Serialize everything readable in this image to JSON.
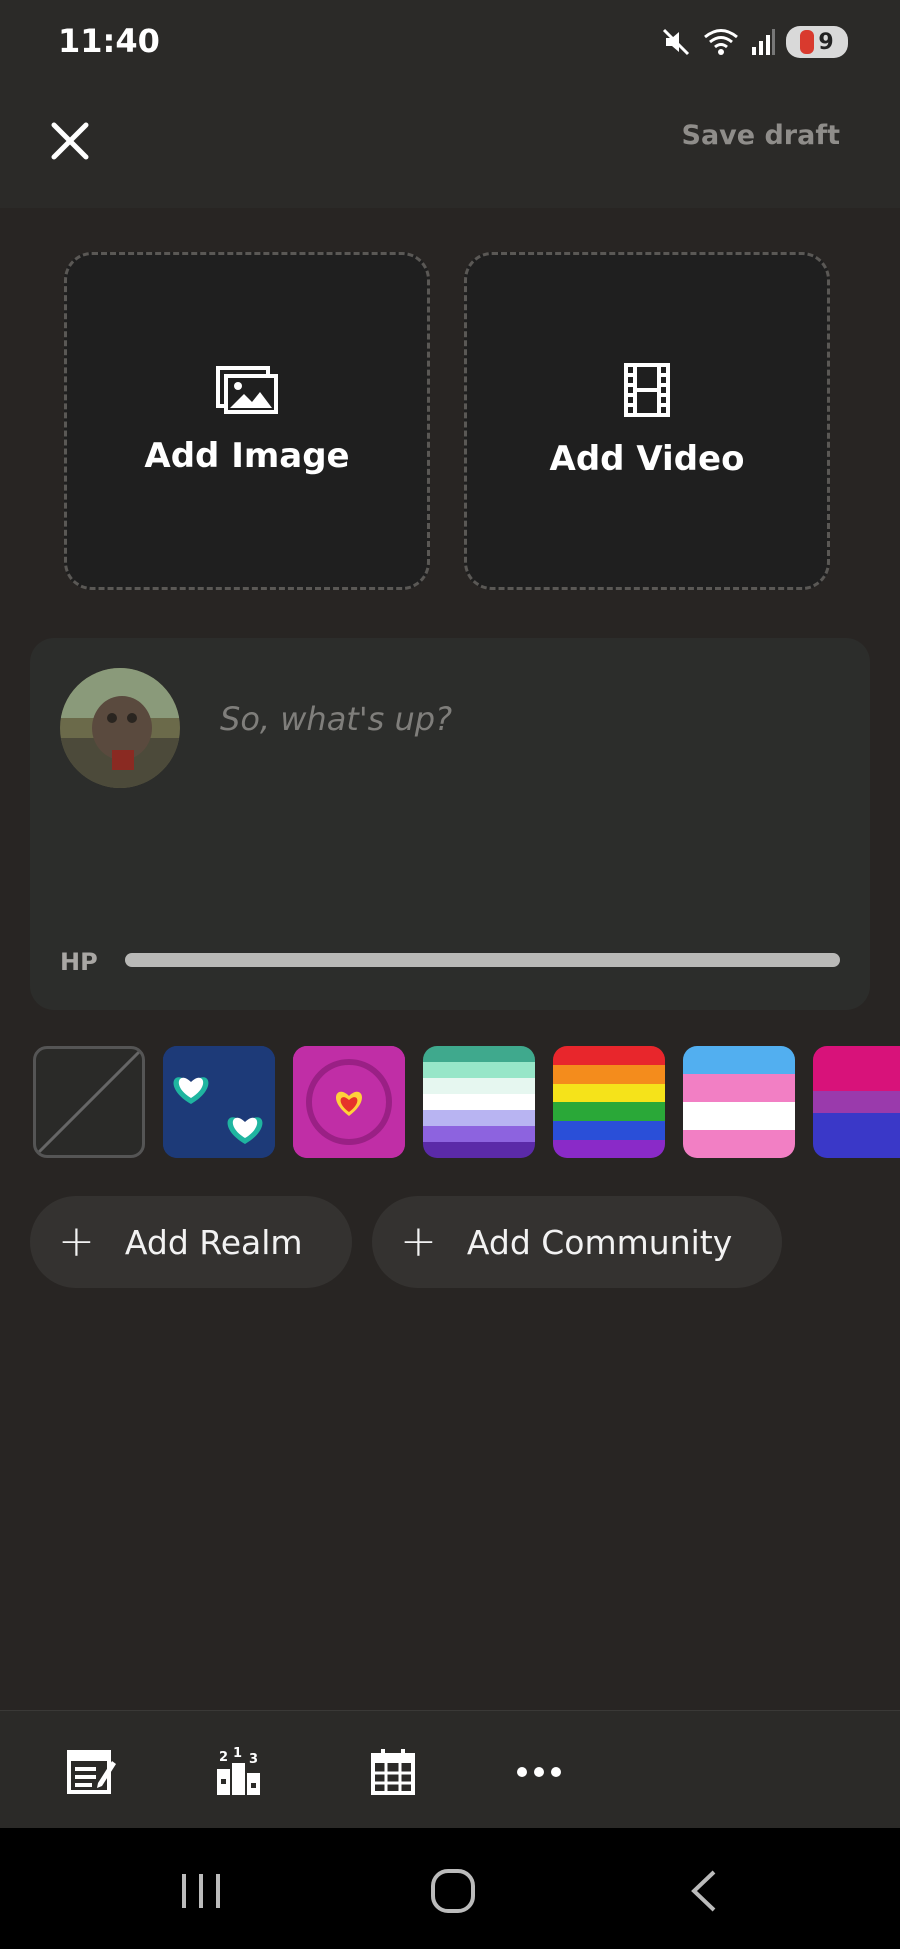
{
  "status": {
    "time": "11:40",
    "battery": "9",
    "icons": [
      "mute-icon",
      "wifi-icon",
      "signal-icon",
      "battery-icon"
    ]
  },
  "topbar": {
    "save_label": "Save draft"
  },
  "media": {
    "image_label": "Add Image",
    "video_label": "Add Video"
  },
  "composer": {
    "placeholder": "So, what's up?",
    "hp_label": "HP",
    "hp_level": 1.0
  },
  "chips": {
    "realm_label": "Add Realm",
    "community_label": "Add Community"
  },
  "colors": {
    "background": "#282523",
    "surface": "#2c2d2b",
    "accent_grey": "#b9b9b7"
  }
}
